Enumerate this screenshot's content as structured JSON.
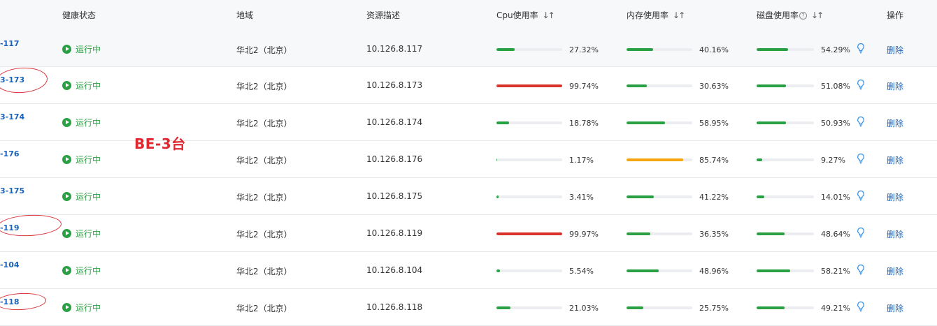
{
  "header": {
    "health": "健康状态",
    "region": "地域",
    "desc": "资源描述",
    "cpu": "Cpu使用率",
    "mem": "内存使用率",
    "disk": "磁盘使用率",
    "ops": "操作"
  },
  "annotation": "BE-3台",
  "colors": {
    "ok": "#29a043",
    "high": "#d9342b",
    "warn": "#f5a50d",
    "link": "#1a63b8"
  },
  "rows": [
    {
      "id": "-117",
      "status": "运行中",
      "region": "华北2（北京）",
      "desc": "10.126.8.117",
      "cpu": "27.32%",
      "cpu_v": 27.32,
      "mem": "40.16%",
      "mem_v": 40.16,
      "disk": "54.29%",
      "disk_v": 54.29,
      "action": "删除"
    },
    {
      "id": "3-173",
      "status": "运行中",
      "region": "华北2（北京）",
      "desc": "10.126.8.173",
      "cpu": "99.74%",
      "cpu_v": 99.74,
      "mem": "30.63%",
      "mem_v": 30.63,
      "disk": "51.08%",
      "disk_v": 51.08,
      "action": "删除"
    },
    {
      "id": "3-174",
      "status": "运行中",
      "region": "华北2（北京）",
      "desc": "10.126.8.174",
      "cpu": "18.78%",
      "cpu_v": 18.78,
      "mem": "58.95%",
      "mem_v": 58.95,
      "disk": "50.93%",
      "disk_v": 50.93,
      "action": "删除"
    },
    {
      "id": "-176",
      "status": "运行中",
      "region": "华北2（北京）",
      "desc": "10.126.8.176",
      "cpu": "1.17%",
      "cpu_v": 1.17,
      "mem": "85.74%",
      "mem_v": 85.74,
      "disk": "9.27%",
      "disk_v": 9.27,
      "action": "删除"
    },
    {
      "id": "3-175",
      "status": "运行中",
      "region": "华北2（北京）",
      "desc": "10.126.8.175",
      "cpu": "3.41%",
      "cpu_v": 3.41,
      "mem": "41.22%",
      "mem_v": 41.22,
      "disk": "14.01%",
      "disk_v": 14.01,
      "action": "删除"
    },
    {
      "id": "-119",
      "status": "运行中",
      "region": "华北2（北京）",
      "desc": "10.126.8.119",
      "cpu": "99.97%",
      "cpu_v": 99.97,
      "mem": "36.35%",
      "mem_v": 36.35,
      "disk": "48.64%",
      "disk_v": 48.64,
      "action": "删除"
    },
    {
      "id": "-104",
      "status": "运行中",
      "region": "华北2（北京）",
      "desc": "10.126.8.104",
      "cpu": "5.54%",
      "cpu_v": 5.54,
      "mem": "48.96%",
      "mem_v": 48.96,
      "disk": "58.21%",
      "disk_v": 58.21,
      "action": "删除"
    },
    {
      "id": "-118",
      "status": "运行中",
      "region": "华北2（北京）",
      "desc": "10.126.8.118",
      "cpu": "21.03%",
      "cpu_v": 21.03,
      "mem": "25.75%",
      "mem_v": 25.75,
      "disk": "49.21%",
      "disk_v": 49.21,
      "action": "删除"
    }
  ]
}
